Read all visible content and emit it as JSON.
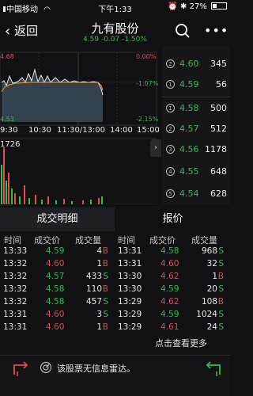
{
  "status_bar": {
    "carrier": "中国移动",
    "time": "下午1:33",
    "battery": "27%"
  },
  "nav": {
    "back_label": "返回",
    "title": "九有股份",
    "subtitle": "4.59  -0.07  -1.50%"
  },
  "chart": {
    "price_labels": {
      "top": "4.68",
      "bottom": "4.53"
    },
    "pct_labels": {
      "top": "0.00%",
      "mid": "-1.07%",
      "bottom": "-2.15%"
    },
    "time_labels": [
      "9:30",
      "10:30",
      "11:30/13:00",
      "14:00",
      "15:00"
    ],
    "volume_label": "1726"
  },
  "quote": {
    "asks": [
      {
        "idx": "2",
        "price": "4.60",
        "vol": "345"
      },
      {
        "idx": "1",
        "price": "4.59",
        "vol": "56"
      }
    ],
    "bids": [
      {
        "idx": "1",
        "price": "4.58",
        "vol": "500"
      },
      {
        "idx": "2",
        "price": "4.57",
        "vol": "512"
      },
      {
        "idx": "3",
        "price": "4.56",
        "vol": "1178"
      },
      {
        "idx": "4",
        "price": "4.55",
        "vol": "648"
      },
      {
        "idx": "5",
        "price": "4.54",
        "vol": "628"
      }
    ]
  },
  "tabs": [
    "成交明细",
    "报价"
  ],
  "table": {
    "headers": [
      "时间",
      "成交价",
      "成交量",
      "时间",
      "成交价",
      "成交量"
    ],
    "left": [
      {
        "time": "13:33",
        "price": "4.59",
        "vol": "4",
        "side": "B"
      },
      {
        "time": "13:32",
        "price": "4.60",
        "vol": "1",
        "side": "B"
      },
      {
        "time": "13:32",
        "price": "4.57",
        "vol": "433",
        "side": "S"
      },
      {
        "time": "13:32",
        "price": "4.58",
        "vol": "110",
        "side": "B"
      },
      {
        "time": "13:32",
        "price": "4.58",
        "vol": "457",
        "side": "S"
      },
      {
        "time": "13:31",
        "price": "4.60",
        "vol": "3",
        "side": "S"
      },
      {
        "time": "13:31",
        "price": "4.60",
        "vol": "1",
        "side": "B"
      }
    ],
    "right": [
      {
        "time": "13:31",
        "price": "4.58",
        "vol": "968",
        "side": "S"
      },
      {
        "time": "13:31",
        "price": "4.60",
        "vol": "32",
        "side": "S"
      },
      {
        "time": "13:30",
        "price": "4.62",
        "vol": "1",
        "side": "B"
      },
      {
        "time": "13:30",
        "price": "4.59",
        "vol": "20",
        "side": "S"
      },
      {
        "time": "13:29",
        "price": "4.62",
        "vol": "108",
        "side": "B"
      },
      {
        "time": "13:29",
        "price": "4.59",
        "vol": "1024",
        "side": "S"
      },
      {
        "time": "13:29",
        "price": "4.61",
        "vol": "24",
        "side": "S"
      }
    ],
    "more_label": "点击查看更多"
  },
  "bottom": {
    "radar_text": "该股票无信息雷达。"
  },
  "colors": {
    "up": "#e34b4b",
    "down": "#2bc24a",
    "accent": "#f0a020",
    "bg": "#111114"
  }
}
